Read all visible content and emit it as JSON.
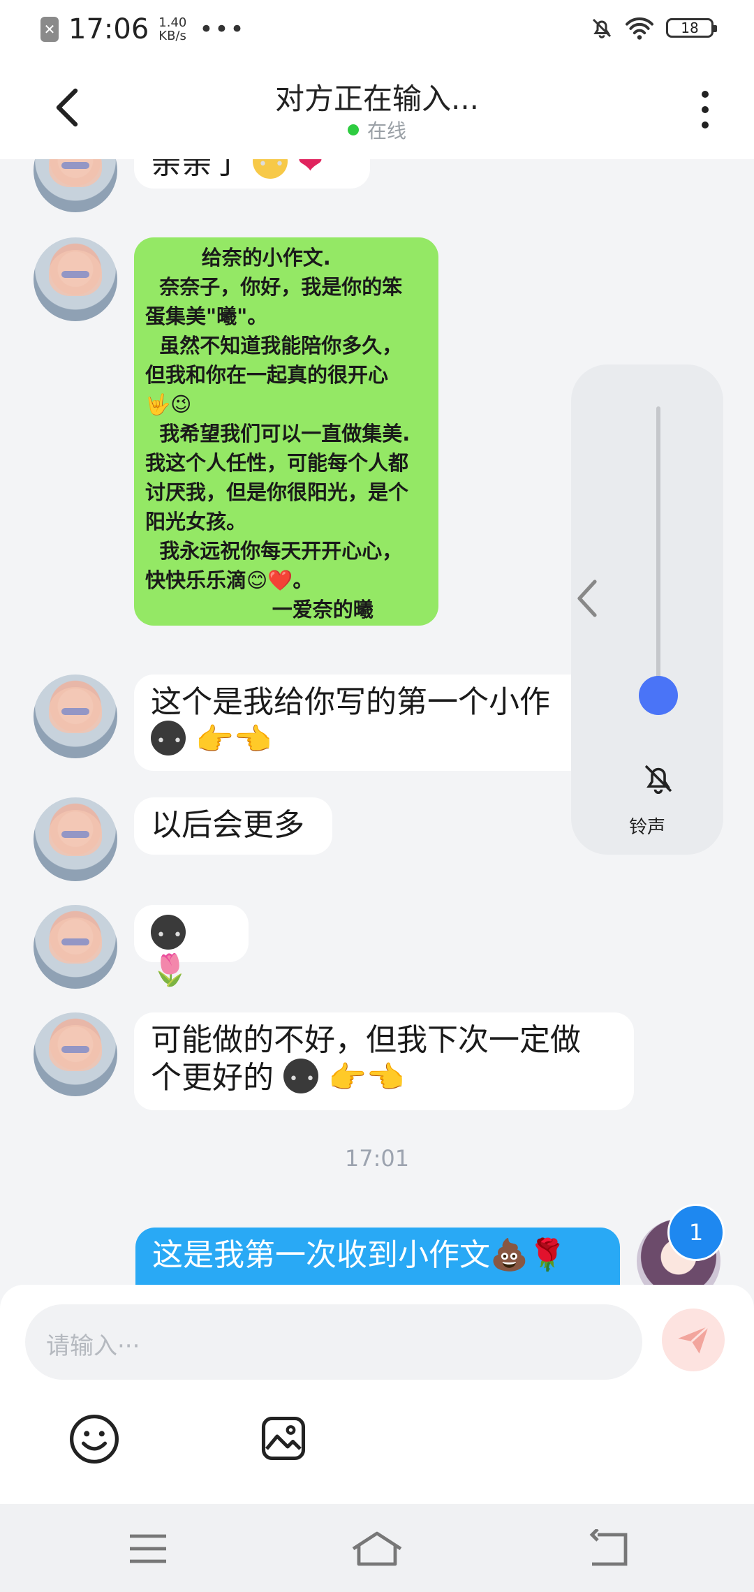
{
  "status_bar": {
    "sim_icon": "sim-x-icon",
    "sim_glyph": "✕",
    "time": "17:06",
    "speed_value": "1.40",
    "speed_unit": "KB/s",
    "more": "•••",
    "battery": "18"
  },
  "header": {
    "title": "对方正在输入...",
    "status": "在线",
    "status_color": "#2ecc40"
  },
  "messages": {
    "msg0_partial": "亲亲了",
    "letter": "        给奈的小作文.\n  奈奈子，你好，我是你的笨\n蛋集美\"曦\"。\n  虽然不知道我能陪你多久，\n但我和你在一起真的很开心\n🤟😉\n  我希望我们可以一直做集美.\n我这个人任性，可能每个人都\n讨厌我，但是你很阳光，是个\n阳光女孩。\n  我永远祝你每天开开心心，\n快快乐乐滴😊❤️。\n                  一爱奈的曦",
    "msg2_text": "这个是我给你写的第一个小作",
    "msg2_emoji": "👉👈",
    "msg3": "以后会更多",
    "msg4_emoji": "🌷",
    "msg5_line1": "可能做的不好，但我下次一定做",
    "msg5_line2": "个更好的",
    "msg5_emoji": "👉👈",
    "timestamp": "17:01",
    "mine": "这是我第一次收到小作文💩🌹",
    "unread": "1"
  },
  "volume": {
    "label": "铃声",
    "level": 0.06
  },
  "input": {
    "placeholder": "请输入···"
  },
  "colors": {
    "accent": "#29a9f5",
    "letter_bubble": "#94e865",
    "knob": "#4a74f7",
    "send": "#f07468"
  }
}
